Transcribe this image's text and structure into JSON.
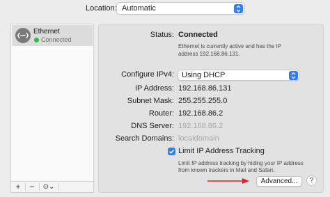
{
  "location": {
    "label": "Location:",
    "value": "Automatic"
  },
  "sidebar": {
    "items": [
      {
        "name": "Ethernet",
        "status": "Connected",
        "icon": "ethernet-icon",
        "status_color": "#29c13a"
      }
    ],
    "toolbar": {
      "add": "+",
      "remove": "−",
      "more": "⊙⌄"
    }
  },
  "detail": {
    "status_label": "Status:",
    "status_value": "Connected",
    "status_desc_line1": "Ethernet is currently active and has the IP",
    "status_desc_line2": "address 192.168.86.131.",
    "configure_label": "Configure IPv4:",
    "configure_value": "Using DHCP",
    "ip_label": "IP Address:",
    "ip_value": "192.168.86.131",
    "subnet_label": "Subnet Mask:",
    "subnet_value": "255.255.255.0",
    "router_label": "Router:",
    "router_value": "192.168.86.2",
    "dns_label": "DNS Server:",
    "dns_value": "192.168.86.2",
    "search_label": "Search Domains:",
    "search_value": "localdomain",
    "limit_label": "Limit IP Address Tracking",
    "limit_checked": true,
    "limit_desc_line1": "Limit IP address tracking by hiding your IP address",
    "limit_desc_line2": "from known trackers in Mail and Safari.",
    "advanced_label": "Advanced...",
    "help_label": "?"
  },
  "colors": {
    "accent": "#2f7df6",
    "annotation_arrow": "#e0202a"
  }
}
